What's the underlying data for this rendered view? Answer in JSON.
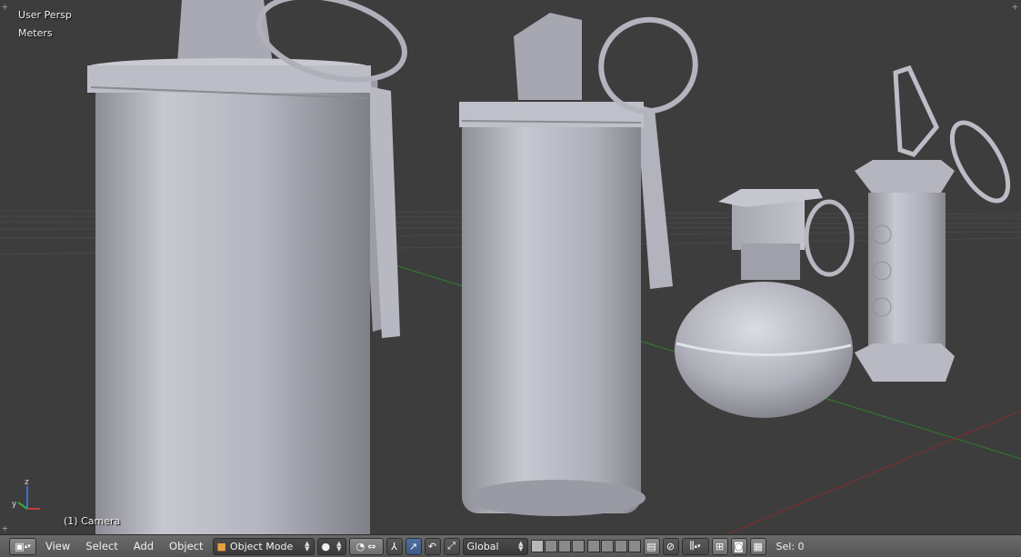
{
  "viewport": {
    "view_name": "User Persp",
    "units": "Meters",
    "object_label": "(1) Camera"
  },
  "header": {
    "menu": [
      "View",
      "Select",
      "Add",
      "Object"
    ],
    "mode": "Object Mode",
    "orientation": "Global",
    "status": "Sel: 0"
  },
  "colors": {
    "background": "#3d3d3d",
    "grid": "#4a4a4a",
    "x_axis": "#8b2b2b",
    "y_axis": "#2e7d2e",
    "model": "#b9b9c4",
    "header": "#5f5f5f"
  },
  "icons": [
    "editor-type-icon",
    "object-cube-icon",
    "viewport-shading-icon",
    "pivot-icon",
    "manipulator-icon",
    "translate-icon",
    "rotate-icon",
    "scale-icon",
    "layers-icon",
    "lock-icon",
    "snap-icon",
    "proportional-edit-icon",
    "render-icon",
    "camera-render-icon"
  ]
}
